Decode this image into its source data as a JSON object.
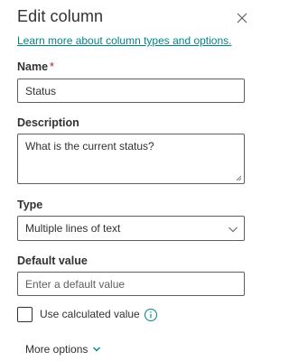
{
  "panel": {
    "title": "Edit column",
    "learn_more_link": "Learn more about column types and options."
  },
  "name_field": {
    "label": "Name",
    "required_marker": "*",
    "value": "Status"
  },
  "description_field": {
    "label": "Description",
    "value": "What is the current status?"
  },
  "type_field": {
    "label": "Type",
    "selected": "Multiple lines of text"
  },
  "default_value_field": {
    "label": "Default value",
    "placeholder": "Enter a default value"
  },
  "calculated": {
    "label": "Use calculated value",
    "checked": false
  },
  "more_options": {
    "label": "More options"
  },
  "colors": {
    "link": "#038387",
    "required": "#a4262c",
    "info_icon": "#038387",
    "chevron_accent": "#038387"
  },
  "icons": {
    "close": "close-icon",
    "dropdown": "chevron-down-icon",
    "info": "info-icon",
    "more": "chevron-down-icon"
  }
}
